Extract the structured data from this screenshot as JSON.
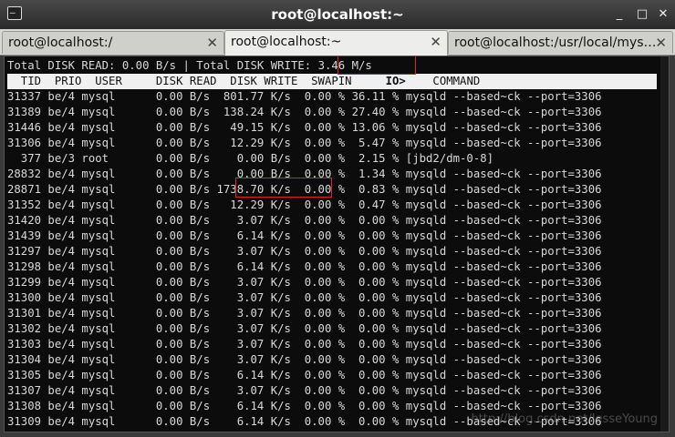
{
  "window": {
    "title": "root@localhost:~",
    "icons": [
      "terminal-icon",
      "minimize-icon",
      "maximize-icon",
      "close-icon"
    ],
    "minimize_glyph": "_",
    "maximize_glyph": "□",
    "close_glyph": "✕"
  },
  "tabs": [
    {
      "label": "root@localhost:/",
      "active": false
    },
    {
      "label": "root@localhost:~",
      "active": true
    },
    {
      "label": "root@localhost:/usr/local/mys…",
      "active": false
    }
  ],
  "tab_close_glyph": "✕",
  "terminal": {
    "summary_prefix": "Total DISK READ: 0.00 B/s | Total DISK WRITE: ",
    "summary_write": "3.46 M/s",
    "header_pre": "  TID  PRIO  USER     DISK READ  DISK WRITE  SWAPIN     ",
    "header_io": "IO>",
    "header_post": "    COMMAND",
    "rows": [
      "31337 be/4 mysql      0.00 B/s  801.77 K/s  0.00 % 36.11 % mysqld --based~ck --port=3306",
      "31389 be/4 mysql      0.00 B/s  138.24 K/s  0.00 % 27.40 % mysqld --based~ck --port=3306",
      "31446 be/4 mysql      0.00 B/s   49.15 K/s  0.00 % 13.06 % mysqld --based~ck --port=3306",
      "31306 be/4 mysql      0.00 B/s   12.29 K/s  0.00 %  5.47 % mysqld --based~ck --port=3306",
      "  377 be/3 root       0.00 B/s    0.00 B/s  0.00 %  2.15 % [jbd2/dm-0-8]",
      "28832 be/4 mysql      0.00 B/s    0.00 B/s  0.00 %  1.34 % mysqld --based~ck --port=3306",
      "28871 be/4 mysql      0.00 B/s 1738.70 K/s  0.00 %  0.83 % mysqld --based~ck --port=3306",
      "31352 be/4 mysql      0.00 B/s   12.29 K/s  0.00 %  0.47 % mysqld --based~ck --port=3306",
      "31420 be/4 mysql      0.00 B/s    3.07 K/s  0.00 %  0.00 % mysqld --based~ck --port=3306",
      "31439 be/4 mysql      0.00 B/s    6.14 K/s  0.00 %  0.00 % mysqld --based~ck --port=3306",
      "31297 be/4 mysql      0.00 B/s    3.07 K/s  0.00 %  0.00 % mysqld --based~ck --port=3306",
      "31298 be/4 mysql      0.00 B/s    6.14 K/s  0.00 %  0.00 % mysqld --based~ck --port=3306",
      "31299 be/4 mysql      0.00 B/s    3.07 K/s  0.00 %  0.00 % mysqld --based~ck --port=3306",
      "31300 be/4 mysql      0.00 B/s    3.07 K/s  0.00 %  0.00 % mysqld --based~ck --port=3306",
      "31301 be/4 mysql      0.00 B/s    3.07 K/s  0.00 %  0.00 % mysqld --based~ck --port=3306",
      "31302 be/4 mysql      0.00 B/s    3.07 K/s  0.00 %  0.00 % mysqld --based~ck --port=3306",
      "31303 be/4 mysql      0.00 B/s    3.07 K/s  0.00 %  0.00 % mysqld --based~ck --port=3306",
      "31304 be/4 mysql      0.00 B/s    3.07 K/s  0.00 %  0.00 % mysqld --based~ck --port=3306",
      "31305 be/4 mysql      0.00 B/s    6.14 K/s  0.00 %  0.00 % mysqld --based~ck --port=3306",
      "31307 be/4 mysql      0.00 B/s    3.07 K/s  0.00 %  0.00 % mysqld --based~ck --port=3306",
      "31308 be/4 mysql      0.00 B/s    6.14 K/s  0.00 %  0.00 % mysqld --based~ck --port=3306",
      "31309 be/4 mysql      0.00 B/s    6.14 K/s  0.00 %  0.00 % mysqld --based~ck --port=3306"
    ]
  },
  "watermark": "http://blog.csdn.net/JesseYoung",
  "colors": {
    "highlight_box": "#dd2222",
    "terminal_bg": "#0c0c0c",
    "terminal_fg": "#d8d8d8"
  }
}
